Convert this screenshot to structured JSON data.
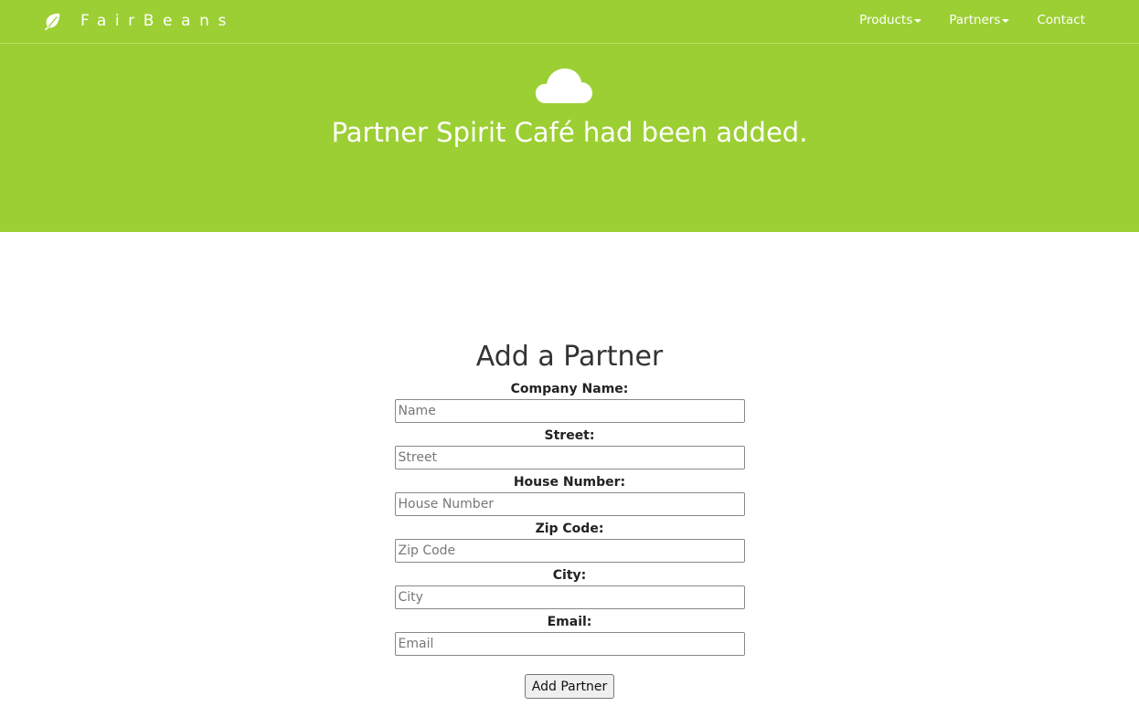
{
  "brand": {
    "name": "FairBeans",
    "icon": "leaf-icon"
  },
  "nav": {
    "items": [
      {
        "label": "Products",
        "has_dropdown": true
      },
      {
        "label": "Partners",
        "has_dropdown": true
      },
      {
        "label": "Contact",
        "has_dropdown": false
      }
    ]
  },
  "hero": {
    "icon": "cloud-icon",
    "message": "Partner Spirit Café had been added."
  },
  "form": {
    "title": "Add a Partner",
    "fields": [
      {
        "label": "Company Name:",
        "placeholder": "Name",
        "value": ""
      },
      {
        "label": "Street:",
        "placeholder": "Street",
        "value": ""
      },
      {
        "label": "House Number:",
        "placeholder": "House Number",
        "value": ""
      },
      {
        "label": "Zip Code:",
        "placeholder": "Zip Code",
        "value": ""
      },
      {
        "label": "City:",
        "placeholder": "City",
        "value": ""
      },
      {
        "label": "Email:",
        "placeholder": "Email",
        "value": ""
      }
    ],
    "submit_label": "Add Partner"
  },
  "colors": {
    "brand_green": "#9ccf33",
    "text_white": "#ffffff"
  }
}
